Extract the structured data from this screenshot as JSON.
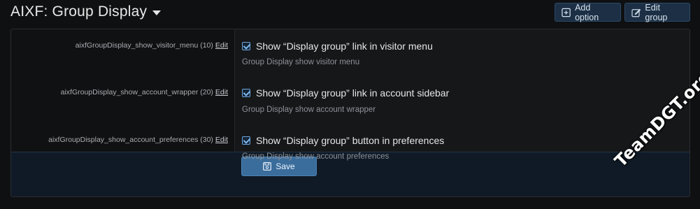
{
  "header": {
    "title": "AIXF: Group Display",
    "add_option_label": "Add option",
    "edit_group_label": "Edit group"
  },
  "options": [
    {
      "key_label": "aixfGroupDisplay_show_visitor_menu (10)",
      "edit_label": "Edit",
      "checkbox_label": "Show “Display group” link in visitor menu",
      "checked": true,
      "hint": "Group Display show visitor menu"
    },
    {
      "key_label": "aixfGroupDisplay_show_account_wrapper (20)",
      "edit_label": "Edit",
      "checkbox_label": "Show “Display group” link in account sidebar",
      "checked": true,
      "hint": "Group Display show account wrapper"
    },
    {
      "key_label": "aixfGroupDisplay_show_account_preferences (30)",
      "edit_label": "Edit",
      "checkbox_label": "Show “Display group” button in preferences",
      "checked": true,
      "hint": "Group Display show account preferences"
    }
  ],
  "footer": {
    "save_label": "Save"
  },
  "watermark": "TeamDGT.org",
  "colors": {
    "background": "#0f1012",
    "accent": "#3a6d9c",
    "header_button_bg": "#1c2f44",
    "checkbox": "#6aa7e0"
  }
}
